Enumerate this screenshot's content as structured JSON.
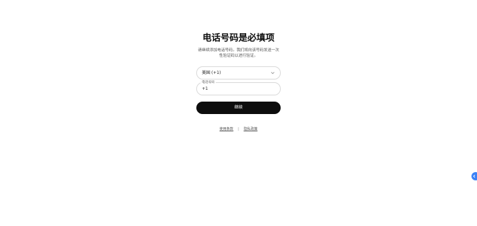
{
  "form": {
    "title": "电话号码是必填项",
    "subtitle_line1": "请继续添加电话号码。我们将向该号码发送一次",
    "subtitle_line2": "性验证码以进行验证。"
  },
  "country": {
    "selected": "美国 (+1)",
    "icon": "chevron-down-icon"
  },
  "phone": {
    "legend": "电话号码",
    "value": "+1"
  },
  "continue_button": {
    "label": "继续"
  },
  "footer": {
    "terms": "使用条款",
    "separator": "|",
    "privacy": "隐私政策"
  },
  "side_tab": {
    "icon": "chevron-left-icon"
  },
  "colors": {
    "button_bg": "#0d0d0d",
    "accent": "#3b82f6"
  }
}
